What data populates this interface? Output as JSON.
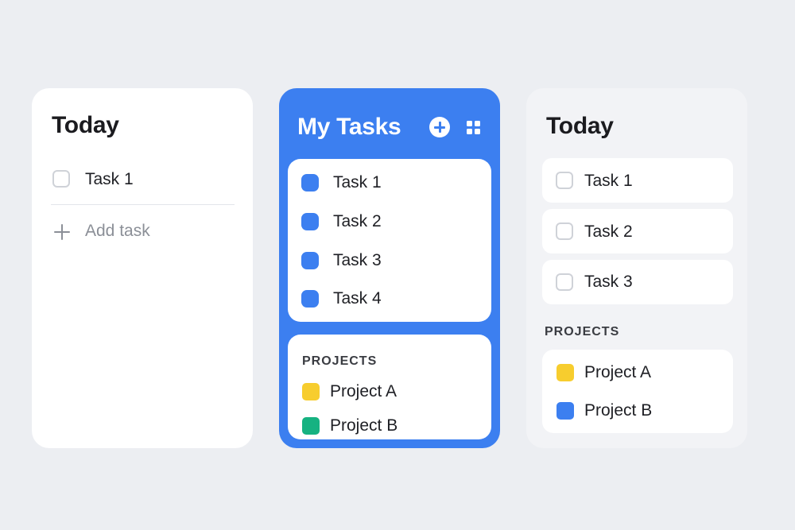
{
  "left_card": {
    "title": "Today",
    "tasks": [
      {
        "label": "Task 1"
      }
    ],
    "add_task_label": "Add task"
  },
  "middle_card": {
    "title": "My Tasks",
    "icons": {
      "add": "plus-circle-icon",
      "grid": "grid-icon"
    },
    "tasks": [
      {
        "label": "Task 1"
      },
      {
        "label": "Task 2"
      },
      {
        "label": "Task 3"
      },
      {
        "label": "Task 4"
      }
    ],
    "projects_heading": "PROJECTS",
    "projects": [
      {
        "label": "Project A",
        "color": "#f7cd2e"
      },
      {
        "label": "Project B",
        "color": "#16b281"
      }
    ],
    "accent": "#3c7ff0"
  },
  "right_card": {
    "title": "Today",
    "tasks": [
      {
        "label": "Task 1"
      },
      {
        "label": "Task 2"
      },
      {
        "label": "Task 3"
      }
    ],
    "projects_heading": "PROJECTS",
    "projects": [
      {
        "label": "Project A",
        "color": "#f7cd2e"
      },
      {
        "label": "Project B",
        "color": "#3c7ff0"
      }
    ]
  }
}
